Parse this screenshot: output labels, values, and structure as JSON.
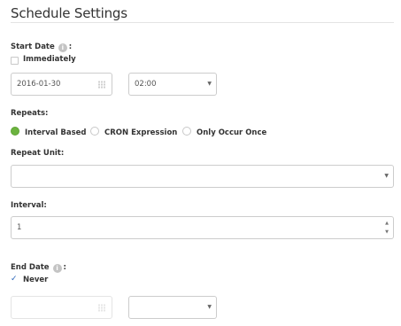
{
  "section_title": "Schedule Settings",
  "start_date": {
    "label": "Start Date",
    "colon": ":",
    "info_icon": "info-icon",
    "immediately_label": "Immediately",
    "immediately_checked": false,
    "date_value": "2016-01-30",
    "time_value": "02:00"
  },
  "repeats": {
    "label": "Repeats:",
    "options": [
      {
        "label": "Interval Based",
        "selected": true
      },
      {
        "label": "CRON Expression",
        "selected": false
      },
      {
        "label": "Only Occur Once",
        "selected": false
      }
    ]
  },
  "repeat_unit": {
    "label": "Repeat Unit:",
    "value": ""
  },
  "interval": {
    "label": "Interval:",
    "value": "1"
  },
  "end_date": {
    "label": "End Date",
    "colon": ":",
    "info_icon": "info-icon",
    "never_label": "Never",
    "never_checked": true,
    "date_value": "",
    "time_value": ""
  },
  "colors": {
    "accent_green": "#6cb33f",
    "check_blue": "#2a66b8"
  }
}
